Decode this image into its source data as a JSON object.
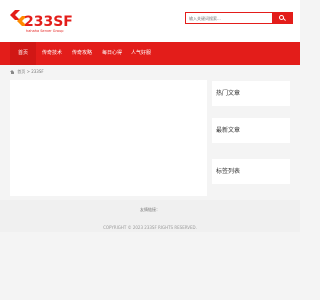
{
  "brand": {
    "logo_text": "233SF",
    "logo_subtext": "hahaha Server Group"
  },
  "search": {
    "placeholder": "输入关键词搜索..."
  },
  "nav": {
    "items": [
      {
        "label": "首页",
        "active": true
      },
      {
        "label": "传奇技术"
      },
      {
        "label": "传奇攻略"
      },
      {
        "label": "每日心得"
      },
      {
        "label": "人气好服"
      }
    ]
  },
  "breadcrumb": {
    "home": "首页",
    "sep": ">",
    "current": "233SF"
  },
  "sidebar": {
    "widgets": [
      "热门文章",
      "最新文章",
      "标签列表"
    ]
  },
  "footer": {
    "links_label": "友情链接：",
    "copyright": "COPYRIGHT © 2023 233SF RIGHTS RESERVED."
  },
  "colors": {
    "accent": "#e31d1a",
    "page_bg": "#f4f4f4"
  }
}
